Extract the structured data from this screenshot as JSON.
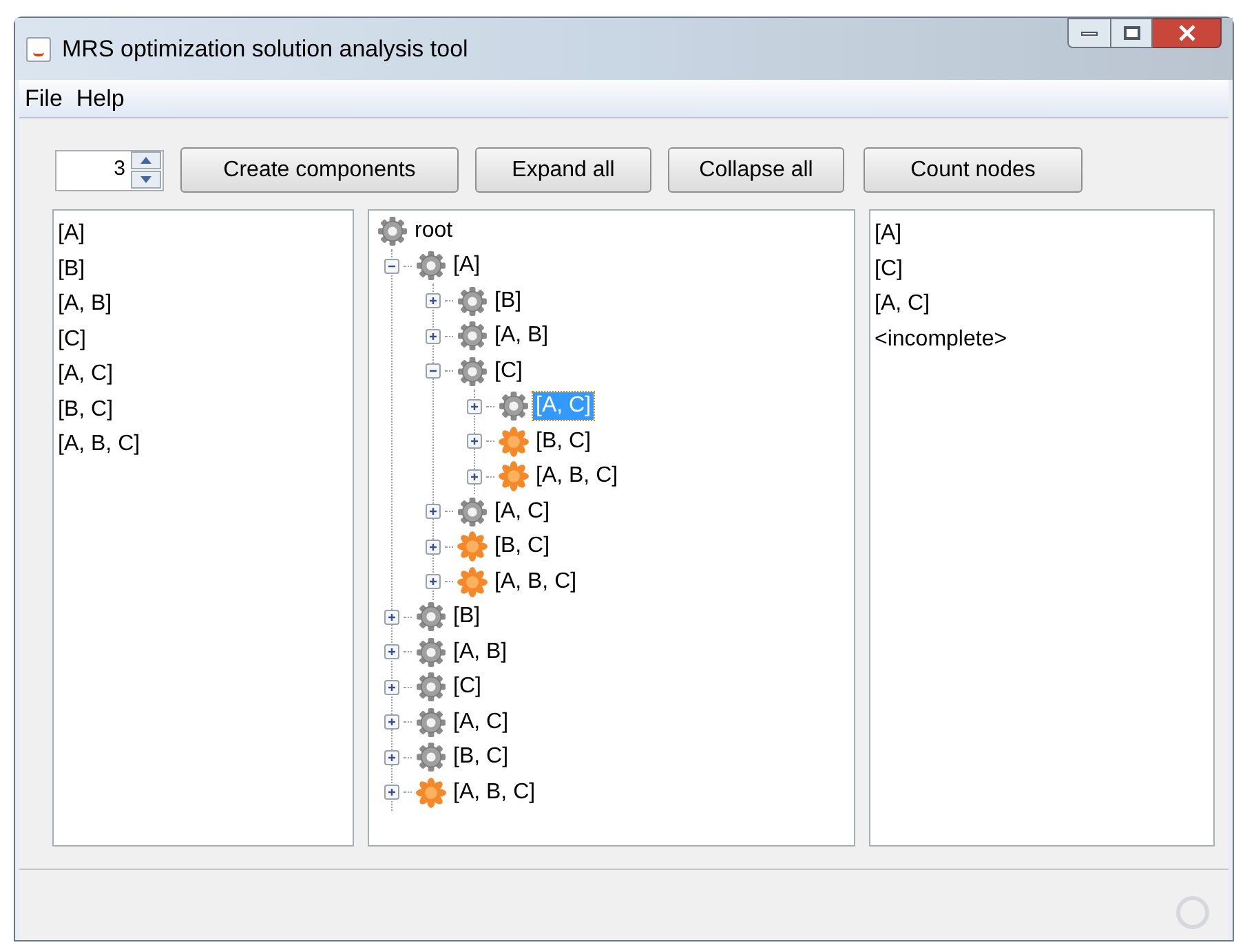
{
  "window": {
    "title": "MRS optimization solution analysis tool"
  },
  "menu": [
    "File",
    "Help"
  ],
  "toolbar": {
    "spinner": {
      "value": "3"
    },
    "buttons": [
      "Create components",
      "Expand all",
      "Collapse all",
      "Count nodes"
    ]
  },
  "left_list": [
    "[A]",
    "[B]",
    "[A, B]",
    "[C]",
    "[A, C]",
    "[B, C]",
    "[A, B, C]"
  ],
  "tree": {
    "label": "root",
    "kind": "gear",
    "selected": false,
    "children": [
      {
        "label": "[A]",
        "kind": "gear",
        "expanded": true,
        "selected": false,
        "children": [
          {
            "label": "[B]",
            "kind": "gear",
            "expanded": false,
            "selected": false
          },
          {
            "label": "[A, B]",
            "kind": "gear",
            "expanded": false,
            "selected": false
          },
          {
            "label": "[C]",
            "kind": "gear",
            "expanded": true,
            "selected": false,
            "children": [
              {
                "label": "[A, C]",
                "kind": "gear",
                "expanded": false,
                "selected": true
              },
              {
                "label": "[B, C]",
                "kind": "star",
                "expanded": false,
                "selected": false
              },
              {
                "label": "[A, B, C]",
                "kind": "star",
                "expanded": false,
                "selected": false
              }
            ]
          },
          {
            "label": "[A, C]",
            "kind": "gear",
            "expanded": false,
            "selected": false
          },
          {
            "label": "[B, C]",
            "kind": "star",
            "expanded": false,
            "selected": false
          },
          {
            "label": "[A, B, C]",
            "kind": "star",
            "expanded": false,
            "selected": false
          }
        ]
      },
      {
        "label": "[B]",
        "kind": "gear",
        "expanded": false,
        "selected": false
      },
      {
        "label": "[A, B]",
        "kind": "gear",
        "expanded": false,
        "selected": false
      },
      {
        "label": "[C]",
        "kind": "gear",
        "expanded": false,
        "selected": false
      },
      {
        "label": "[A, C]",
        "kind": "gear",
        "expanded": false,
        "selected": false
      },
      {
        "label": "[B, C]",
        "kind": "gear",
        "expanded": false,
        "selected": false
      },
      {
        "label": "[A, B, C]",
        "kind": "star",
        "expanded": false,
        "selected": false
      }
    ]
  },
  "right_list": [
    "[A]",
    "[C]",
    "[A, C]",
    "<incomplete>"
  ]
}
